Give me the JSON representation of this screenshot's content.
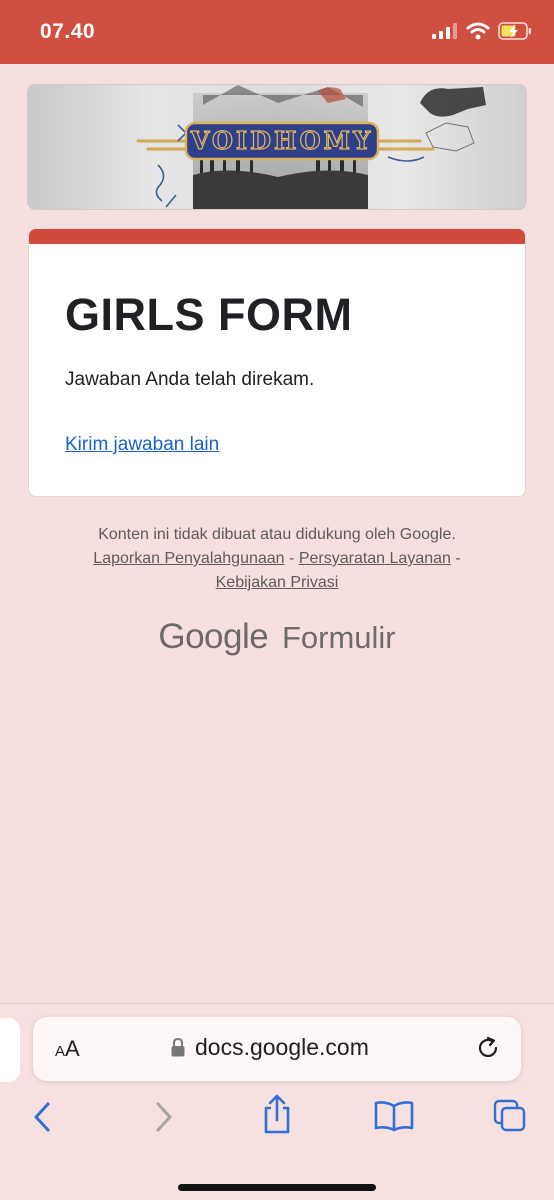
{
  "status_bar": {
    "time": "07.40"
  },
  "banner": {
    "logo_text": "VOIDHOMY"
  },
  "card": {
    "title": "GIRLS FORM",
    "message": "Jawaban Anda telah direkam.",
    "resubmit_link": "Kirim jawaban lain"
  },
  "footer": {
    "disclaimer": "Konten ini tidak dibuat atau didukung oleh Google.",
    "report_abuse": "Laporkan Penyalahgunaan",
    "terms": "Persyaratan Layanan",
    "privacy": "Kebijakan Privasi",
    "sep": "-",
    "brand_google": "Google",
    "brand_product": "Formulir"
  },
  "browser": {
    "text_size_label": "AA",
    "url": "docs.google.com"
  },
  "colors": {
    "accent": "#d04a3c",
    "status_bar": "#cf4f41",
    "page_bg": "#f6e0df",
    "link": "#1a62c9",
    "ios_blue": "#2f6fd6"
  }
}
